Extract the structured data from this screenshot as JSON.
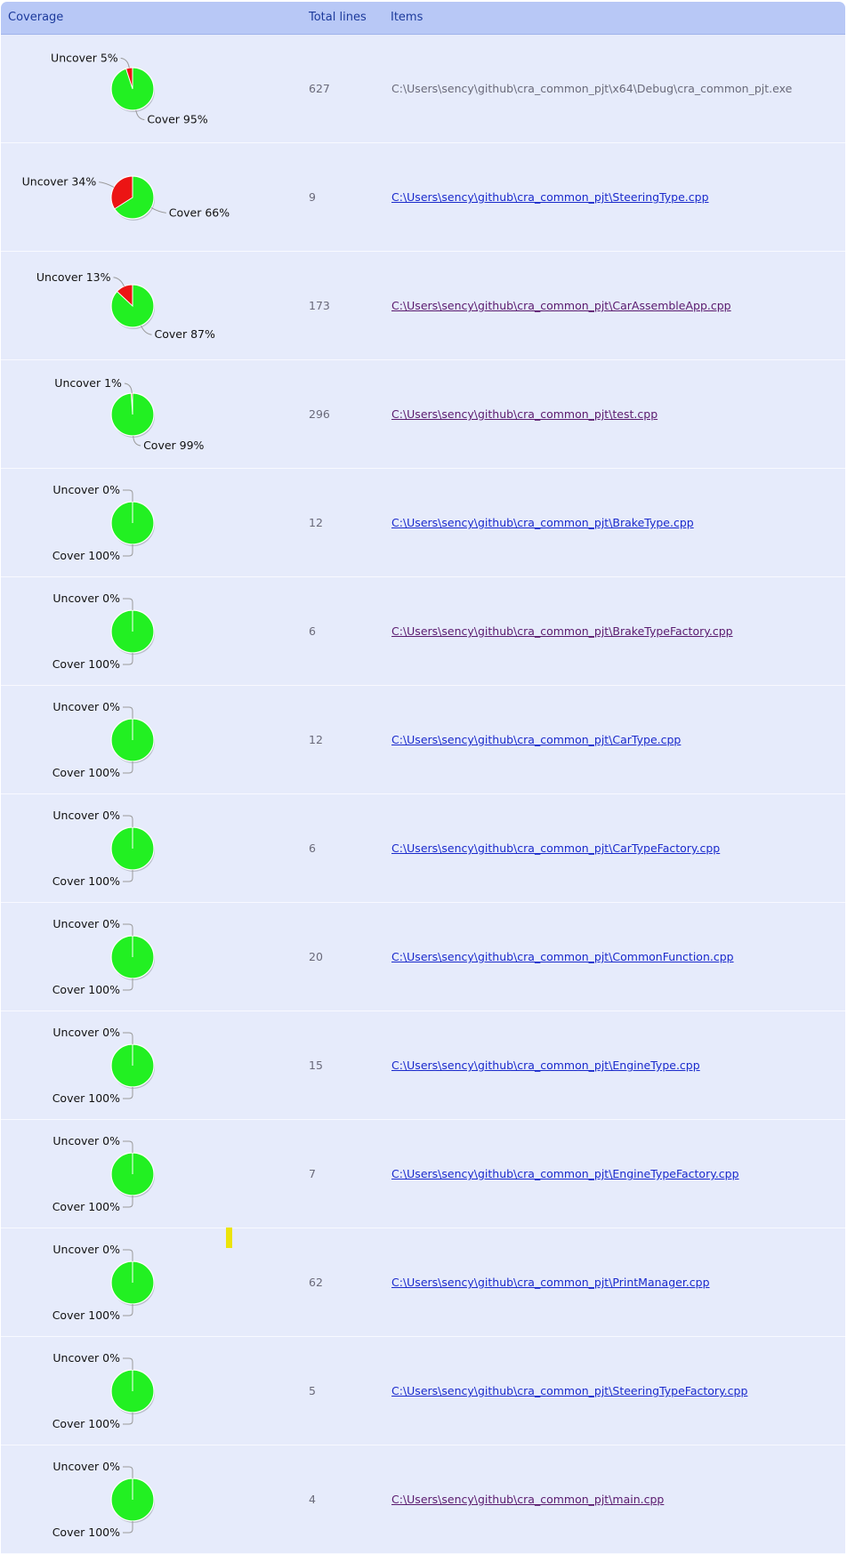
{
  "header": {
    "coverage": "Coverage",
    "total_lines": "Total lines",
    "items": "Items"
  },
  "colors": {
    "cover": "#22f022",
    "uncover": "#ec1414",
    "header_bg": "#b8c8f6",
    "row_bg": "#e6ebfb",
    "link": "#1a2acc",
    "visited": "#5a1a6e",
    "marker": "#ece40a"
  },
  "rows": [
    {
      "uncover_label": "Uncover 5%",
      "cover_label": "Cover 95%",
      "uncover_pct": 5,
      "total_lines": "627",
      "item": "C:\\Users\\sency\\github\\cra_common_pjt\\x64\\Debug\\cra_common_pjt.exe",
      "item_style": "plain"
    },
    {
      "uncover_label": "Uncover 34%",
      "cover_label": "Cover 66%",
      "uncover_pct": 34,
      "total_lines": "9",
      "item": "C:\\Users\\sency\\github\\cra_common_pjt\\SteeringType.cpp",
      "item_style": "link"
    },
    {
      "uncover_label": "Uncover 13%",
      "cover_label": "Cover 87%",
      "uncover_pct": 13,
      "total_lines": "173",
      "item": "C:\\Users\\sency\\github\\cra_common_pjt\\CarAssembleApp.cpp",
      "item_style": "visited"
    },
    {
      "uncover_label": "Uncover 1%",
      "cover_label": "Cover 99%",
      "uncover_pct": 1,
      "total_lines": "296",
      "item": "C:\\Users\\sency\\github\\cra_common_pjt\\test.cpp",
      "item_style": "visited"
    },
    {
      "uncover_label": "Uncover 0%",
      "cover_label": "Cover 100%",
      "uncover_pct": 0,
      "total_lines": "12",
      "item": "C:\\Users\\sency\\github\\cra_common_pjt\\BrakeType.cpp",
      "item_style": "link"
    },
    {
      "uncover_label": "Uncover 0%",
      "cover_label": "Cover 100%",
      "uncover_pct": 0,
      "total_lines": "6",
      "item": "C:\\Users\\sency\\github\\cra_common_pjt\\BrakeTypeFactory.cpp",
      "item_style": "visited"
    },
    {
      "uncover_label": "Uncover 0%",
      "cover_label": "Cover 100%",
      "uncover_pct": 0,
      "total_lines": "12",
      "item": "C:\\Users\\sency\\github\\cra_common_pjt\\CarType.cpp",
      "item_style": "link"
    },
    {
      "uncover_label": "Uncover 0%",
      "cover_label": "Cover 100%",
      "uncover_pct": 0,
      "total_lines": "6",
      "item": "C:\\Users\\sency\\github\\cra_common_pjt\\CarTypeFactory.cpp",
      "item_style": "link"
    },
    {
      "uncover_label": "Uncover 0%",
      "cover_label": "Cover 100%",
      "uncover_pct": 0,
      "total_lines": "20",
      "item": "C:\\Users\\sency\\github\\cra_common_pjt\\CommonFunction.cpp",
      "item_style": "link"
    },
    {
      "uncover_label": "Uncover 0%",
      "cover_label": "Cover 100%",
      "uncover_pct": 0,
      "total_lines": "15",
      "item": "C:\\Users\\sency\\github\\cra_common_pjt\\EngineType.cpp",
      "item_style": "link"
    },
    {
      "uncover_label": "Uncover 0%",
      "cover_label": "Cover 100%",
      "uncover_pct": 0,
      "total_lines": "7",
      "item": "C:\\Users\\sency\\github\\cra_common_pjt\\EngineTypeFactory.cpp",
      "item_style": "link"
    },
    {
      "uncover_label": "Uncover 0%",
      "cover_label": "Cover 100%",
      "uncover_pct": 0,
      "total_lines": "62",
      "item": "C:\\Users\\sency\\github\\cra_common_pjt\\PrintManager.cpp",
      "item_style": "link"
    },
    {
      "uncover_label": "Uncover 0%",
      "cover_label": "Cover 100%",
      "uncover_pct": 0,
      "total_lines": "5",
      "item": "C:\\Users\\sency\\github\\cra_common_pjt\\SteeringTypeFactory.cpp",
      "item_style": "link"
    },
    {
      "uncover_label": "Uncover 0%",
      "cover_label": "Cover 100%",
      "uncover_pct": 0,
      "total_lines": "4",
      "item": "C:\\Users\\sency\\github\\cra_common_pjt\\main.cpp",
      "item_style": "visited"
    }
  ]
}
